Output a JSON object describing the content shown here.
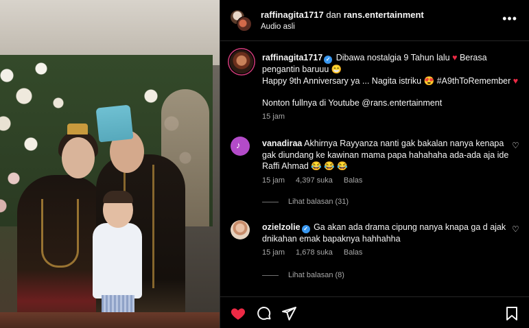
{
  "post": {
    "author": "raffinagita1717",
    "connector": "dan",
    "collaborator": "rans.entertainment",
    "audio": "Audio asli"
  },
  "caption": {
    "username": "raffinagita1717",
    "line1": "Dibawa nostalgia 9 Tahun lalu",
    "line1b": "Berasa pengantin baruuu",
    "line2": "Happy 9th Anniversary ya ... Nagita istriku",
    "hashtag": "#A9thToRemember",
    "line3": "Nonton fullnya di Youtube @rans.entertainment",
    "time": "15 jam"
  },
  "comments": [
    {
      "username": "vanadiraa",
      "text": "Akhirnya Rayyanza nanti gak bakalan nanya kenapa gak diundang ke kawinan mama papa hahahaha ada-ada aja ide Raffi Ahmad",
      "emoji": "😂 😂 😂",
      "time": "15 jam",
      "likes": "4,397 suka",
      "reply": "Balas",
      "view_replies": "Lihat balasan (31)"
    },
    {
      "username": "ozielzolie",
      "text": "Ga akan ada drama cipung nanya knapa ga d ajak dnikahan emak bapaknya hahhahha",
      "time": "15 jam",
      "likes": "1,678 suka",
      "reply": "Balas",
      "view_replies": "Lihat balasan (8)"
    }
  ],
  "icons": {
    "more": "more-options-icon",
    "like": "heart-icon",
    "comment": "comment-icon",
    "share": "send-icon",
    "save": "bookmark-icon"
  },
  "colors": {
    "like_active": "#ed2a45",
    "verified": "#3897f0",
    "muted_text": "#a8a8a8"
  }
}
